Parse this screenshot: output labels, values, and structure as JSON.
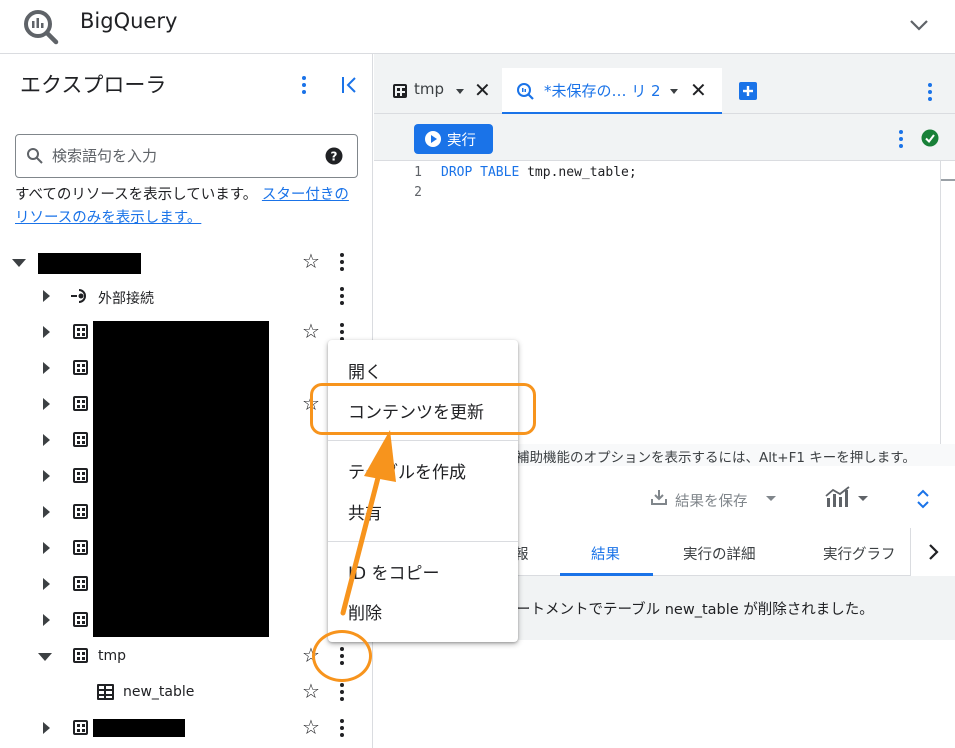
{
  "app": {
    "title": "BigQuery"
  },
  "explorer": {
    "title": "エクスプローラ",
    "search_placeholder": "検索語句を入力",
    "resource_message": "すべてのリソースを表示しています。",
    "resource_link": "スター付きのリソースのみを表示します。",
    "rows": [
      {
        "label": "",
        "kind": "project",
        "expanded": true
      },
      {
        "label": "外部接続",
        "kind": "connection"
      },
      {
        "label": "",
        "kind": "dataset"
      },
      {
        "label": "",
        "kind": "dataset"
      },
      {
        "label": "",
        "kind": "dataset"
      },
      {
        "label": "",
        "kind": "dataset"
      },
      {
        "label": "",
        "kind": "dataset"
      },
      {
        "label": "",
        "kind": "dataset"
      },
      {
        "label": "",
        "kind": "dataset"
      },
      {
        "label": "",
        "kind": "dataset"
      },
      {
        "label": "",
        "kind": "dataset"
      },
      {
        "label": "tmp",
        "kind": "dataset",
        "expanded": true
      },
      {
        "label": "new_table",
        "kind": "table"
      },
      {
        "label": "",
        "kind": "dataset"
      }
    ]
  },
  "editor": {
    "tabs": [
      {
        "label": "tmp",
        "icon": "table-icon",
        "active": false
      },
      {
        "label": "*未保存の… リ 2",
        "icon": "query-icon",
        "active": true
      }
    ],
    "run_label": "実行",
    "code_lines": [
      {
        "number": "1",
        "keywords": "DROP TABLE",
        "rest": " tmp.new_table;"
      },
      {
        "number": "2",
        "keywords": "",
        "rest": ""
      }
    ],
    "accessibility_message": "補助機能のオプションを表示するには、Alt+F1 キーを押します。"
  },
  "results": {
    "save_label": "結果を保存",
    "tabs": [
      "報",
      "結果",
      "実行の詳細",
      "実行グラフ"
    ],
    "active_tab": "結果",
    "message": "ートメントでテーブル new_table が削除されました。"
  },
  "context_menu": {
    "items": [
      "開く",
      "コンテンツを更新",
      "テーブルを作成",
      "共有",
      "ID をコピー",
      "削除"
    ]
  },
  "colors": {
    "accent": "#1a73e8",
    "annotation": "#f7941d",
    "success": "#188038"
  }
}
